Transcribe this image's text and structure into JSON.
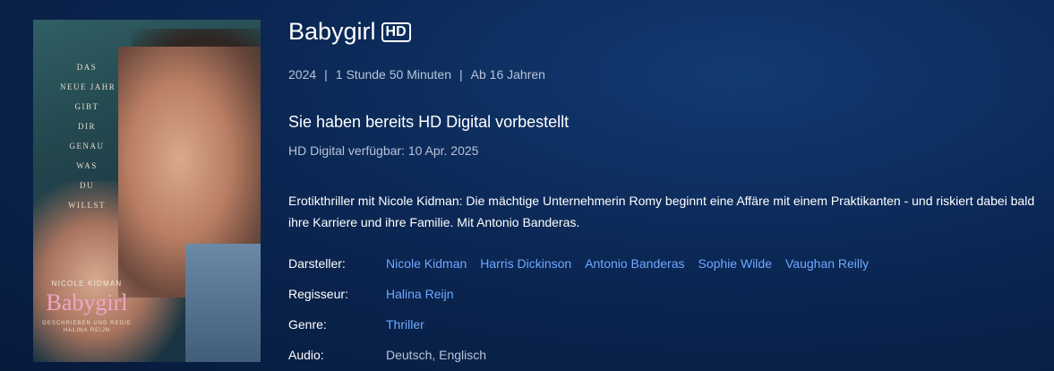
{
  "poster": {
    "tagline": [
      "DAS",
      "NEUE JAHR",
      "GIBT",
      "DIR",
      "GENAU",
      "WAS",
      "DU",
      "WILLST"
    ],
    "actor": "NICOLE KIDMAN",
    "logo": "Babygirl",
    "credit_line1": "GESCHRIEBEN UND REGIE",
    "credit_line2": "HALINA REIJN"
  },
  "title": "Babygirl",
  "badge": "HD",
  "meta": {
    "year": "2024",
    "duration": "1 Stunde 50 Minuten",
    "rating": "Ab 16 Jahren",
    "separator": "|"
  },
  "status": {
    "headline": "Sie haben bereits HD Digital vorbestellt",
    "availability": "HD Digital verfügbar: 10 Apr. 2025"
  },
  "description": "Erotikthriller mit Nicole Kidman: Die mächtige Unternehmerin Romy beginnt eine Affäre mit einem Praktikanten - und riskiert dabei bald ihre Karriere und ihre Familie. Mit Antonio Banderas.",
  "details": {
    "cast_label": "Darsteller:",
    "cast": [
      "Nicole Kidman",
      "Harris Dickinson",
      "Antonio Banderas",
      "Sophie Wilde",
      "Vaughan Reilly"
    ],
    "director_label": "Regisseur:",
    "director": "Halina Reijn",
    "genre_label": "Genre:",
    "genre": "Thriller",
    "audio_label": "Audio:",
    "audio": "Deutsch, Englisch"
  },
  "colors": {
    "background": "#0b2754",
    "link": "#6fa9ff",
    "muted_text": "#b7c4d8"
  }
}
